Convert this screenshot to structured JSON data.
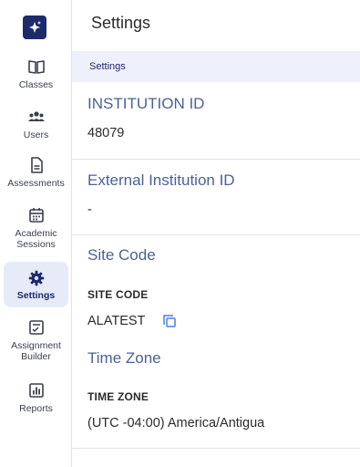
{
  "sidebar": {
    "logo_icon": "sparkle-icon",
    "items": [
      {
        "label": "Classes",
        "icon": "book-open-icon"
      },
      {
        "label": "Users",
        "icon": "users-icon"
      },
      {
        "label": "Assessments",
        "icon": "document-icon"
      },
      {
        "label": "Academic Sessions",
        "icon": "calendar-icon"
      },
      {
        "label": "Settings",
        "icon": "gear-icon",
        "active": true
      },
      {
        "label": "Assignment Builder",
        "icon": "checklist-icon"
      },
      {
        "label": "Reports",
        "icon": "bar-chart-icon"
      }
    ]
  },
  "header": {
    "title": "Settings"
  },
  "breadcrumb": "Settings",
  "sections": {
    "institution_id": {
      "title": "INSTITUTION ID",
      "value": "48079"
    },
    "external_id": {
      "title": "External Institution ID",
      "value": "-"
    },
    "site_code": {
      "title": "Site Code",
      "label": "SITE CODE",
      "value": "ALATEST"
    },
    "time_zone": {
      "title": "Time Zone",
      "label": "TIME ZONE",
      "value": "(UTC -04:00) America/Antigua"
    }
  },
  "colors": {
    "accent": "#1d2a6b",
    "section_title": "#4b6199",
    "breadcrumb_bg": "#eef1fb",
    "active_bg": "#e6ebf7"
  }
}
